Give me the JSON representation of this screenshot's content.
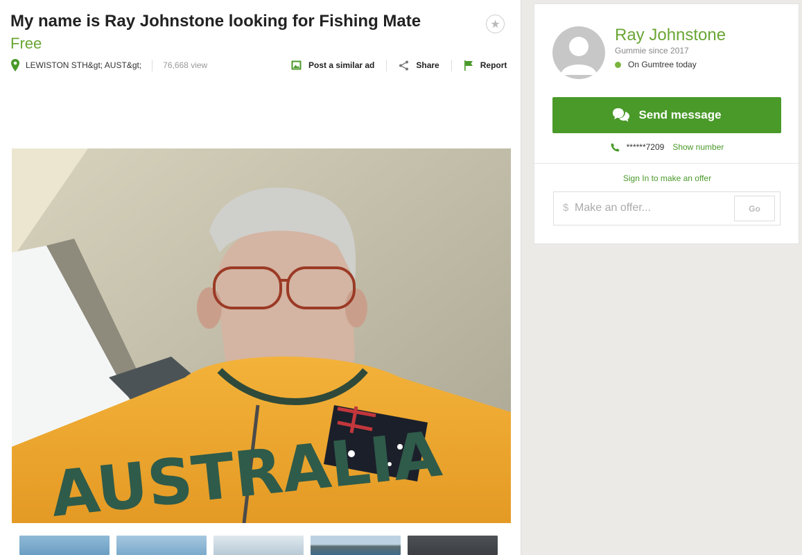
{
  "ad": {
    "title": "My name is Ray Johnstone looking for Fishing Mate",
    "price": "Free",
    "location": "LEWISTON STH&gt; AUST&gt;",
    "views": "76,668 view"
  },
  "actions": {
    "post_similar": "Post a similar ad",
    "share": "Share",
    "report": "Report"
  },
  "icons": {
    "favourite": "star-icon",
    "location": "map-pin-icon",
    "post_similar": "image-icon",
    "share": "share-icon",
    "report": "flag-icon",
    "message": "chat-bubbles-icon",
    "phone": "phone-icon"
  },
  "seller": {
    "name": "Ray Johnstone",
    "since": "Gummie since 2017",
    "status": "On Gumtree today",
    "send_message": "Send message",
    "phone_masked": "******7209",
    "show_number": "Show number"
  },
  "offer": {
    "sign_in_link": "Sign In to make an offer",
    "currency": "$",
    "placeholder": "Make an offer...",
    "go": "Go"
  },
  "colors": {
    "brand_green": "#6aa634",
    "button_green": "#4a9a2a"
  }
}
